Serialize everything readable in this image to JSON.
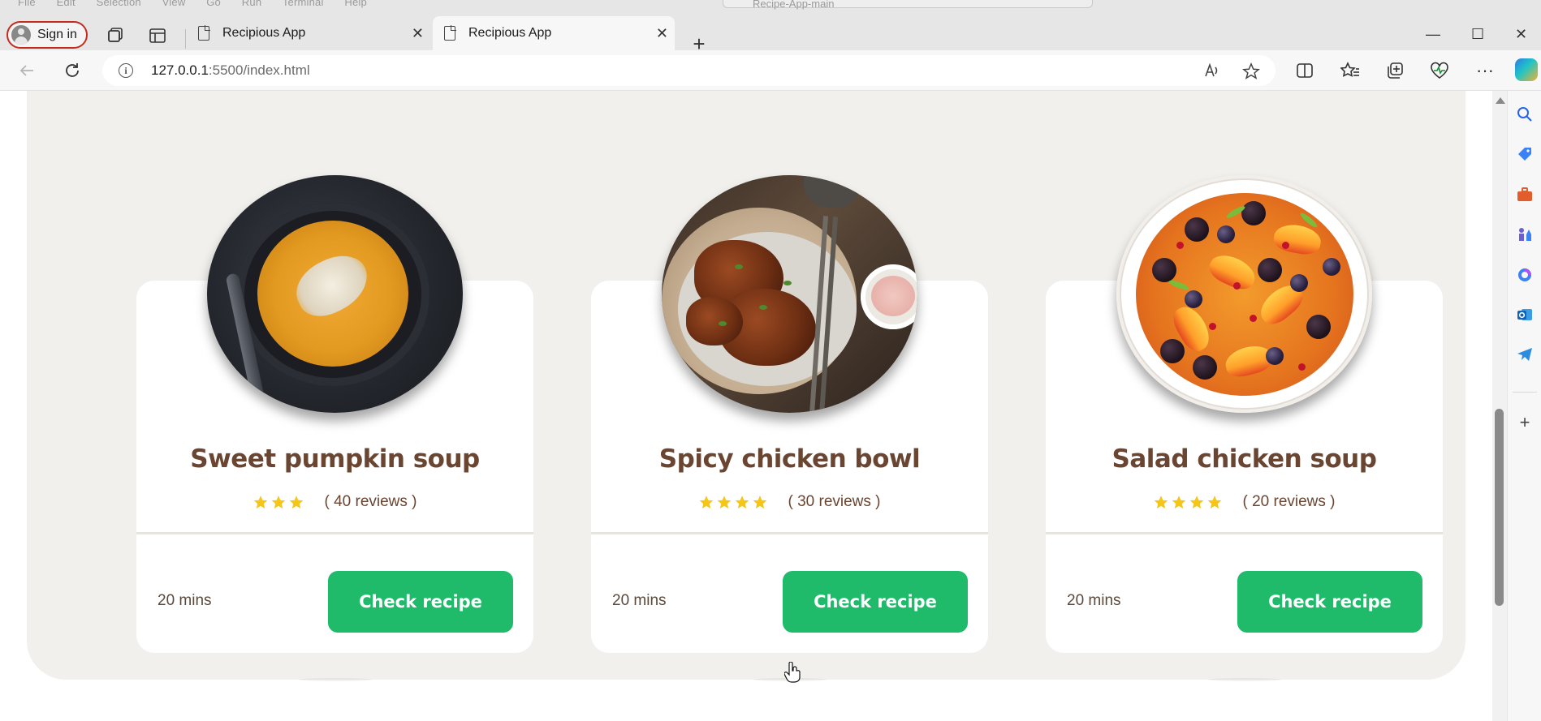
{
  "window": {
    "editor_menu": [
      "File",
      "Edit",
      "Selection",
      "View",
      "Go",
      "Run",
      "Terminal",
      "Help"
    ],
    "editor_search": "Recipe-App-main",
    "minimize": "—",
    "maximize": "☐",
    "close": "✕"
  },
  "browser": {
    "signin_label": "Sign in",
    "tabs": [
      {
        "title": "Recipious App",
        "active": false
      },
      {
        "title": "Recipious App",
        "active": true
      }
    ],
    "new_tab": "+",
    "url_host": "127.0.0.1",
    "url_path": ":5500/index.html",
    "more": "···"
  },
  "recipes": [
    {
      "title": "Sweet pumpkin soup",
      "stars": 3,
      "reviews": "( 40 reviews )",
      "time": "20 mins",
      "button": "Check recipe"
    },
    {
      "title": "Spicy chicken bowl",
      "stars": 4,
      "reviews": "( 30 reviews )",
      "time": "20 mins",
      "button": "Check recipe"
    },
    {
      "title": "Salad chicken soup",
      "stars": 4,
      "reviews": "( 20 reviews )",
      "time": "20 mins",
      "button": "Check recipe"
    }
  ],
  "colors": {
    "accent_button": "#1fba6a",
    "title_brown": "#6a4531",
    "star_gold": "#f5c518",
    "section_bg": "#f1f0ec",
    "signin_border": "#c42b1c"
  }
}
